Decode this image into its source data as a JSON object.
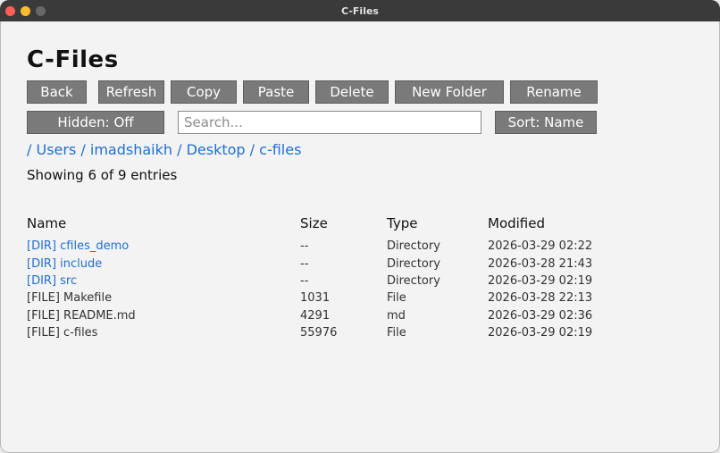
{
  "window": {
    "title": "C-Files"
  },
  "app": {
    "title": "C-Files"
  },
  "toolbar": {
    "buttons": [
      {
        "label": "Back"
      },
      {
        "label": "Refresh"
      },
      {
        "label": "Copy"
      },
      {
        "label": "Paste"
      },
      {
        "label": "Delete"
      },
      {
        "label": "New Folder"
      },
      {
        "label": "Rename"
      }
    ]
  },
  "controls": {
    "hidden_label": "Hidden: Off",
    "search_placeholder": "Search...",
    "search_value": "",
    "sort_label": "Sort: Name"
  },
  "breadcrumb": {
    "segments": [
      "Users",
      "imadshaikh",
      "Desktop",
      "c-files"
    ],
    "separator": "/"
  },
  "status": {
    "text": "Showing 6 of 9 entries"
  },
  "table": {
    "headers": [
      "Name",
      "Size",
      "Type",
      "Modified"
    ],
    "rows": [
      {
        "name": "[DIR] cfiles_demo",
        "size": "--",
        "type": "Directory",
        "modified": "2026-03-29 02:22",
        "is_dir": true
      },
      {
        "name": "[DIR] include",
        "size": "--",
        "type": "Directory",
        "modified": "2026-03-28 21:43",
        "is_dir": true
      },
      {
        "name": "[DIR] src",
        "size": "--",
        "type": "Directory",
        "modified": "2026-03-29 02:19",
        "is_dir": true
      },
      {
        "name": "[FILE] Makefile",
        "size": "1031",
        "type": "File",
        "modified": "2026-03-28 22:13",
        "is_dir": false
      },
      {
        "name": "[FILE] README.md",
        "size": "4291",
        "type": "md",
        "modified": "2026-03-29 02:36",
        "is_dir": false
      },
      {
        "name": "[FILE] c-files",
        "size": "55976",
        "type": "File",
        "modified": "2026-03-29 02:19",
        "is_dir": false
      }
    ]
  },
  "colors": {
    "button_bg": "#7a7a7a",
    "link": "#1f6fd1",
    "titlebar": "#3a3a3a"
  }
}
